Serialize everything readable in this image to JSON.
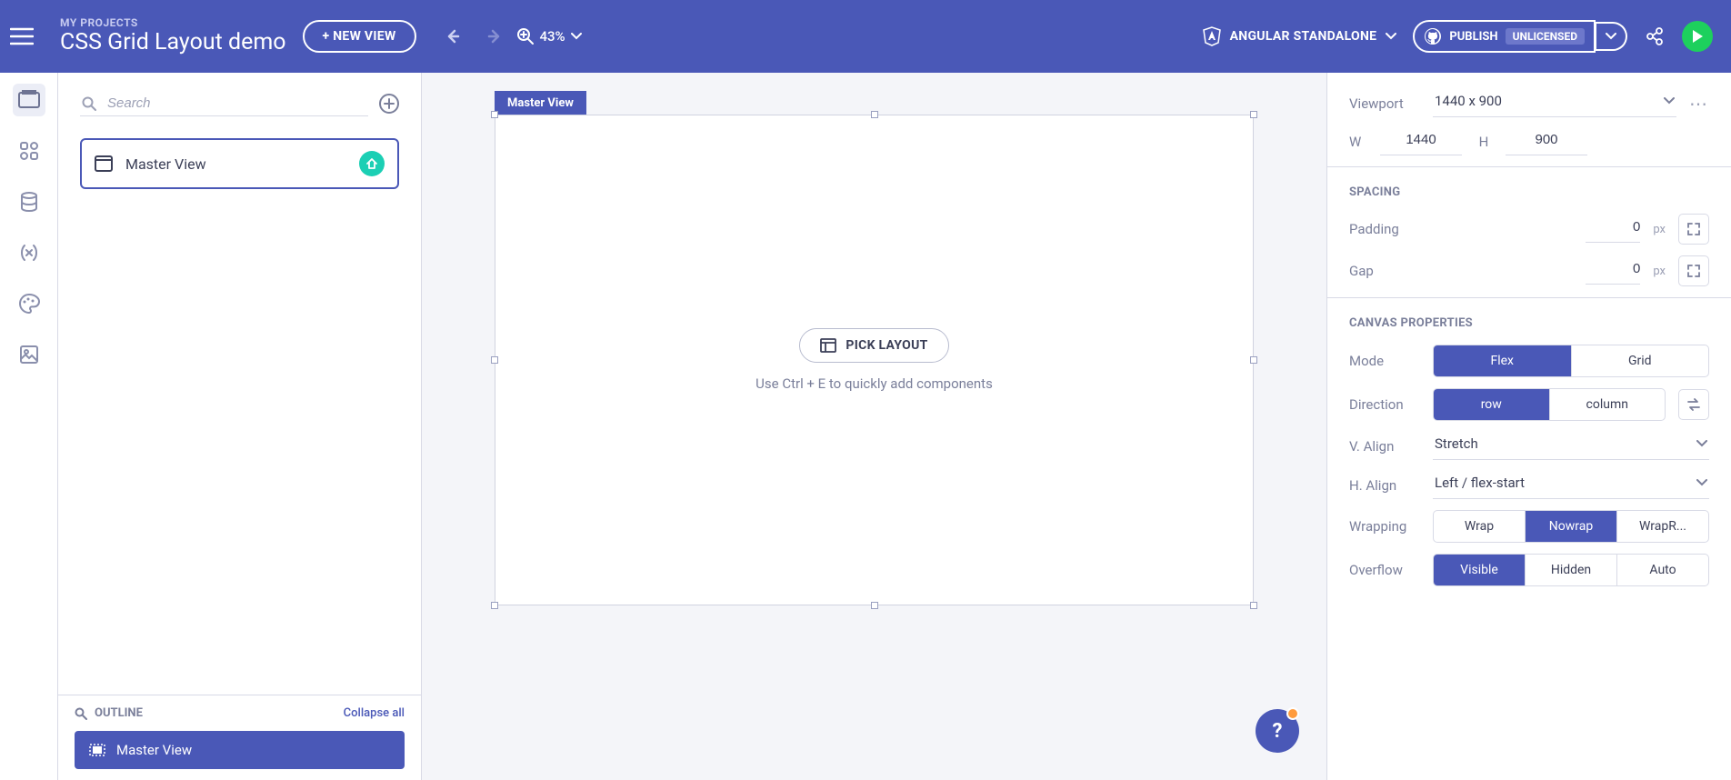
{
  "header": {
    "breadcrumb": "MY PROJECTS",
    "title": "CSS Grid Layout demo",
    "new_view": "+ NEW VIEW",
    "zoom": "43%",
    "framework": "ANGULAR STANDALONE",
    "publish": "PUBLISH",
    "publish_badge": "UNLICENSED"
  },
  "sidebar": {
    "search_placeholder": "Search",
    "views": [
      {
        "label": "Master View",
        "is_home": true
      }
    ],
    "outline_title": "OUTLINE",
    "collapse": "Collapse all",
    "outline_items": [
      {
        "label": "Master View"
      }
    ]
  },
  "canvas": {
    "tab": "Master View",
    "pick_layout": "PICK LAYOUT",
    "hint": "Use Ctrl + E to quickly add components"
  },
  "props": {
    "viewport_label": "Viewport",
    "viewport_value": "1440 x 900",
    "w_label": "W",
    "w_value": "1440",
    "h_label": "H",
    "h_value": "900",
    "spacing_title": "SPACING",
    "padding_label": "Padding",
    "padding_value": "0",
    "padding_unit": "px",
    "gap_label": "Gap",
    "gap_value": "0",
    "gap_unit": "px",
    "canvas_title": "CANVAS PROPERTIES",
    "mode_label": "Mode",
    "mode_options": [
      "Flex",
      "Grid"
    ],
    "direction_label": "Direction",
    "direction_options": [
      "row",
      "column"
    ],
    "valign_label": "V. Align",
    "valign_value": "Stretch",
    "halign_label": "H. Align",
    "halign_value": "Left / flex-start",
    "wrapping_label": "Wrapping",
    "wrapping_options": [
      "Wrap",
      "Nowrap",
      "WrapR..."
    ],
    "overflow_label": "Overflow",
    "overflow_options": [
      "Visible",
      "Hidden",
      "Auto"
    ]
  }
}
